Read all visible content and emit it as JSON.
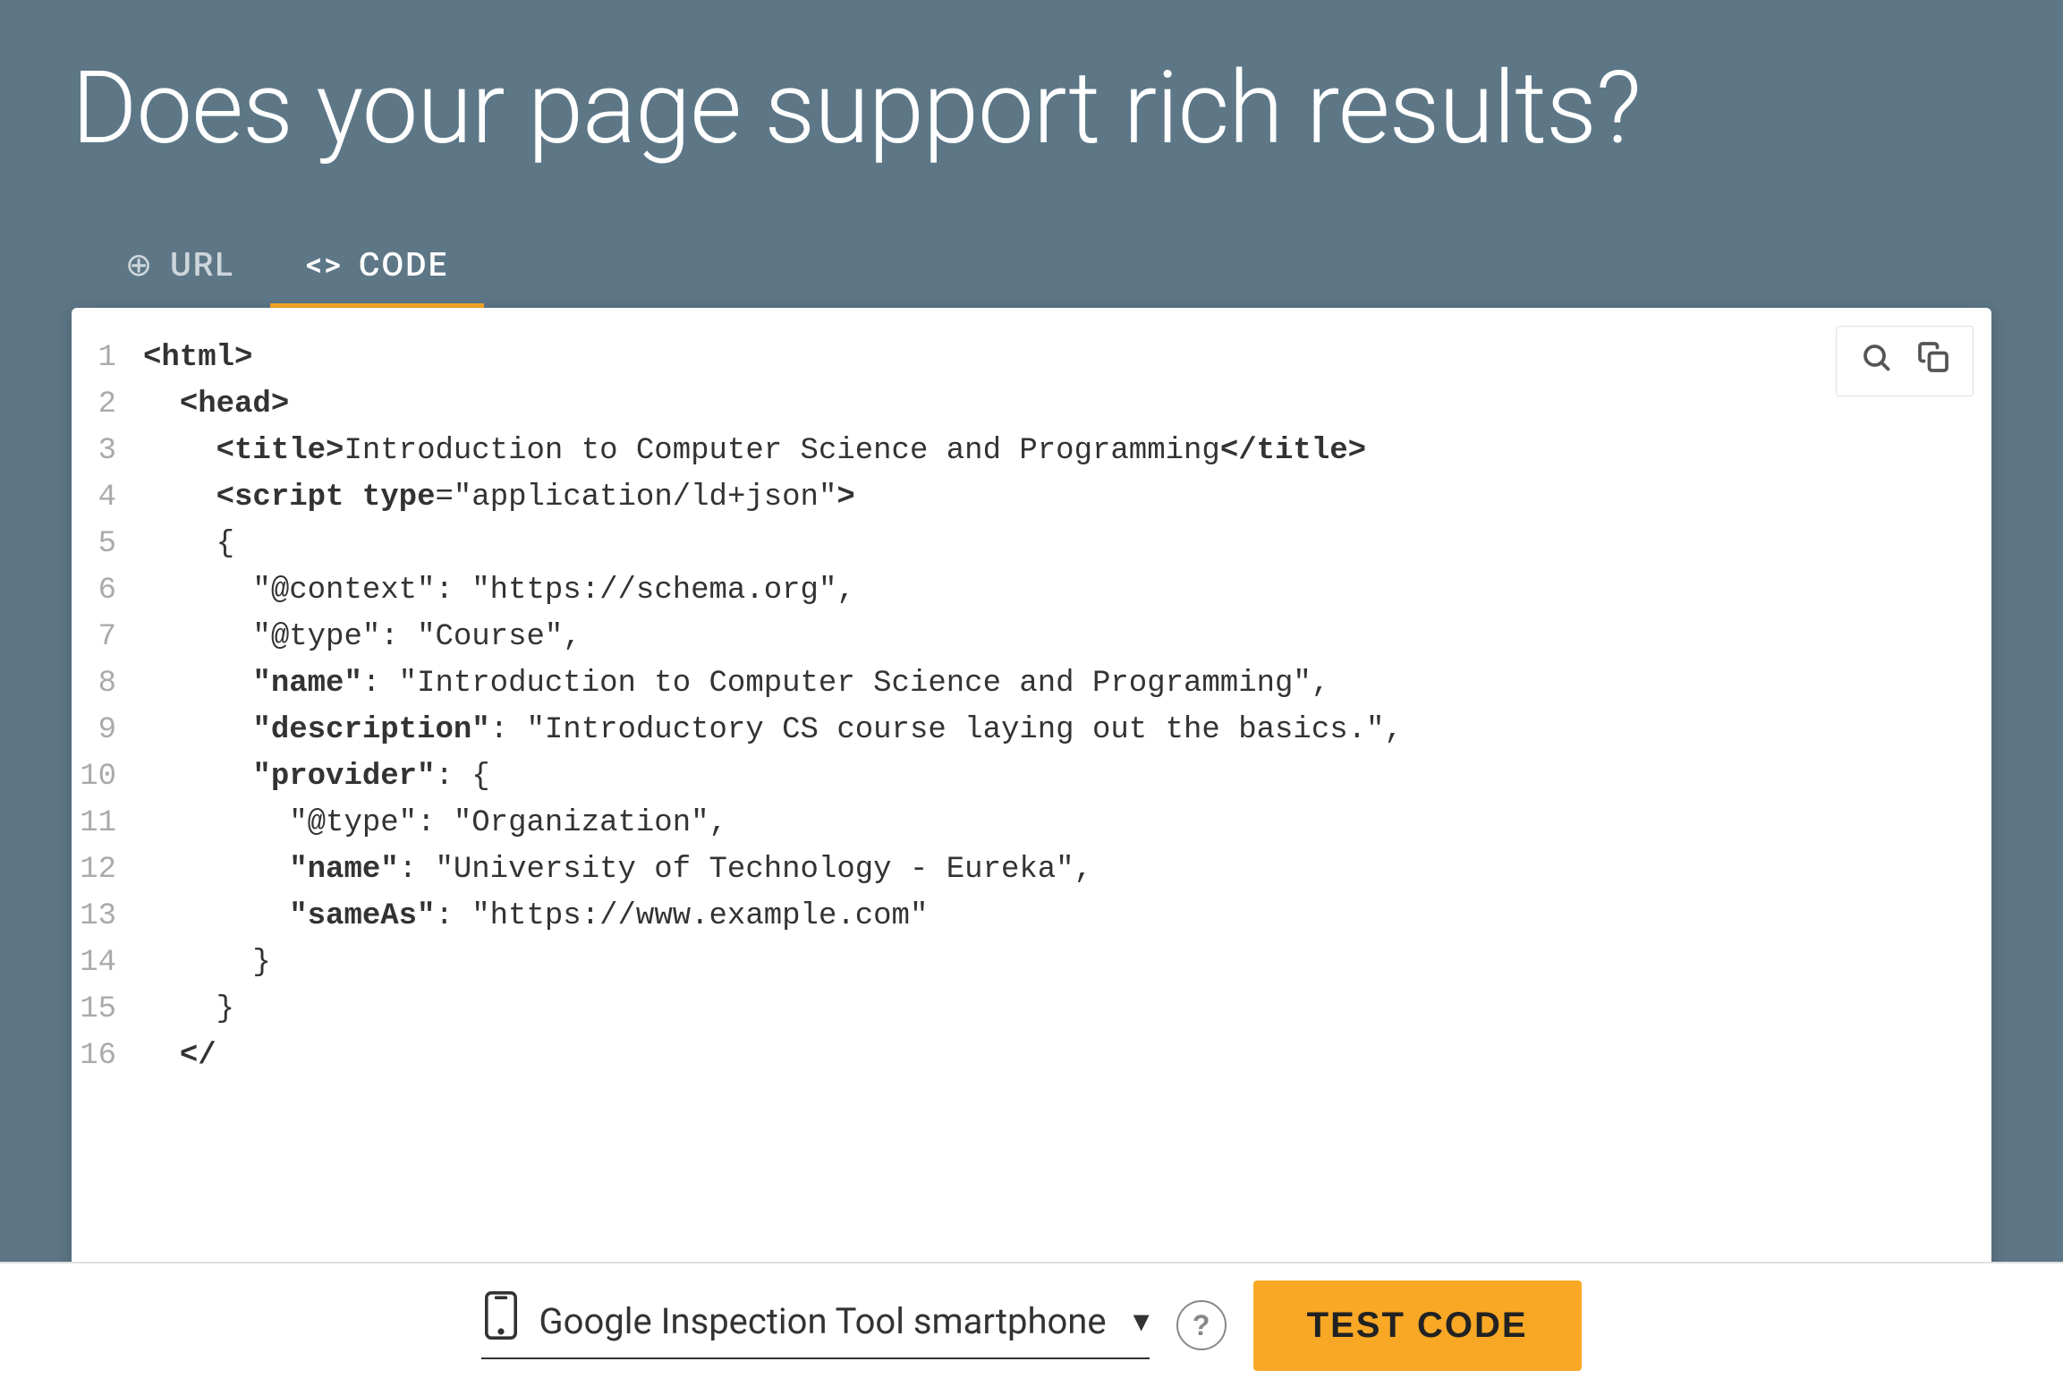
{
  "page": {
    "headline": "Does your page support rich results?",
    "background_color": "#5d7787"
  },
  "tabs": [
    {
      "id": "url",
      "label": "URL",
      "icon": "🌐",
      "active": false
    },
    {
      "id": "code",
      "label": "CODE",
      "icon": "<>",
      "active": true
    }
  ],
  "toolbar": {
    "search_label": "🔍",
    "copy_label": "⧉"
  },
  "code_lines": [
    {
      "num": "1",
      "content": "<html>"
    },
    {
      "num": "2",
      "content": "  <head>"
    },
    {
      "num": "3",
      "content": "    <title>Introduction to Computer Science and Programming</title>"
    },
    {
      "num": "4",
      "content": "    <script type=\"application/ld+json\">"
    },
    {
      "num": "5",
      "content": "    {"
    },
    {
      "num": "6",
      "content": "      \"@context\": \"https://schema.org\","
    },
    {
      "num": "7",
      "content": "      \"@type\": \"Course\","
    },
    {
      "num": "8",
      "content": "      \"name\": \"Introduction to Computer Science and Programming\","
    },
    {
      "num": "9",
      "content": "      \"description\": \"Introductory CS course laying out the basics.\","
    },
    {
      "num": "10",
      "content": "      \"provider\": {"
    },
    {
      "num": "11",
      "content": "        \"@type\": \"Organization\","
    },
    {
      "num": "12",
      "content": "        \"name\": \"University of Technology - Eureka\","
    },
    {
      "num": "13",
      "content": "        \"sameAs\": \"https://www.example.com\""
    },
    {
      "num": "14",
      "content": "      }"
    },
    {
      "num": "15",
      "content": "    }"
    },
    {
      "num": "16",
      "content": "  </"
    }
  ],
  "bottom_bar": {
    "device_icon": "📱",
    "device_label": "Google Inspection Tool smartphone",
    "chevron": "▾",
    "help_label": "?",
    "test_button_label": "TEST CODE"
  }
}
